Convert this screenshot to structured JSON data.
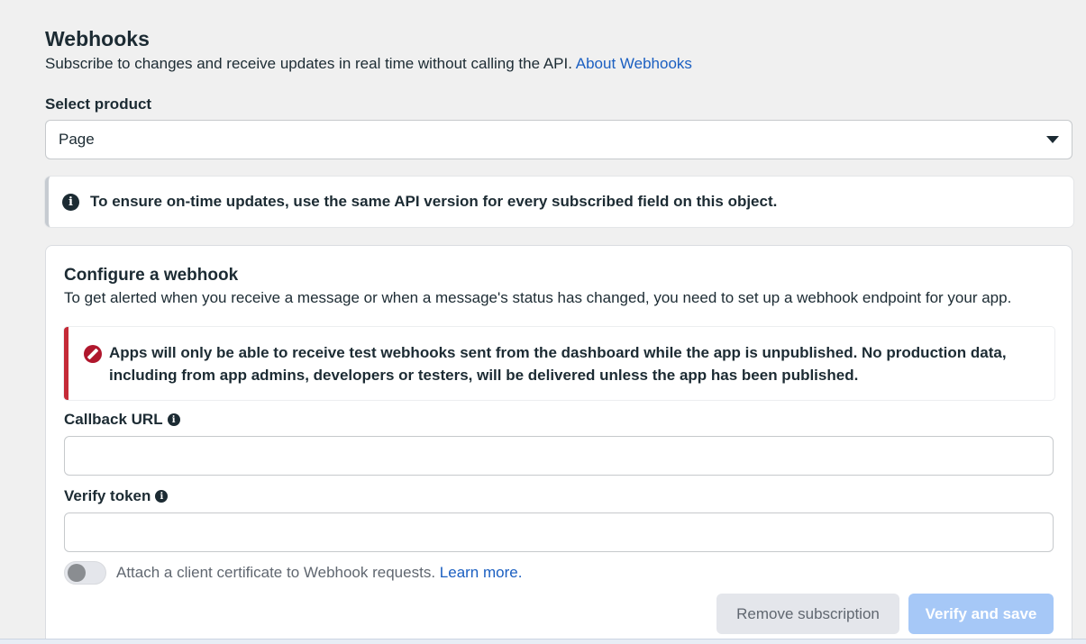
{
  "header": {
    "title": "Webhooks",
    "subtitle": "Subscribe to changes and receive updates in real time without calling the API.",
    "about_link": "About Webhooks"
  },
  "product": {
    "label": "Select product",
    "selected": "Page"
  },
  "info_banner": {
    "icon": "info-icon",
    "text": "To ensure on-time updates, use the same API version for every subscribed field on this object."
  },
  "configure": {
    "title": "Configure a webhook",
    "description": "To get alerted when you receive a message or when a message's status has changed, you need to set up a webhook endpoint for your app.",
    "warning_icon": "prohibited-icon",
    "warning": "Apps will only be able to receive test webhooks sent from the dashboard while the app is unpublished. No production data, including from app admins, developers or testers, will be delivered unless the app has been published.",
    "callback_label": "Callback URL",
    "callback_value": "",
    "verify_label": "Verify token",
    "verify_value": "",
    "toggle_label": "Attach a client certificate to Webhook requests.",
    "toggle_link": "Learn more.",
    "toggle_state": "off",
    "remove_button": "Remove subscription",
    "save_button": "Verify and save"
  },
  "colors": {
    "link": "#1b5fc1",
    "warning_accent": "#c52a37",
    "save_button_disabled": "#a6c8f7"
  }
}
